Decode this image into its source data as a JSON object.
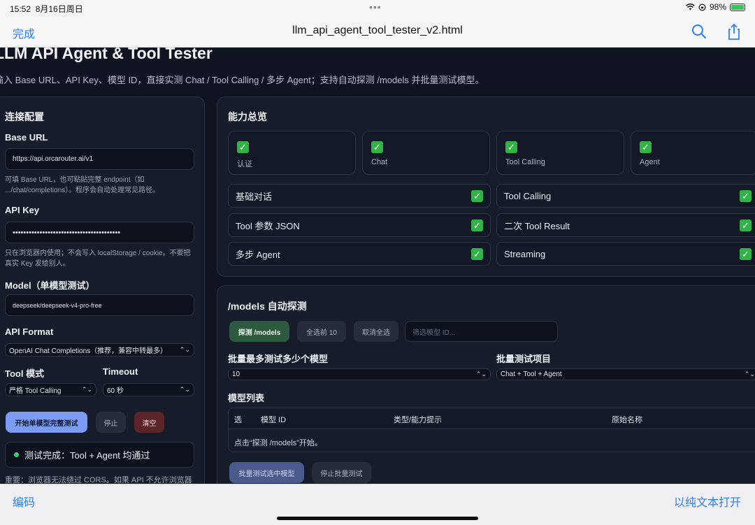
{
  "status_bar": {
    "time": "15:52",
    "date": "8月16日周日",
    "battery_percent": "98%",
    "battery_level": 0.98
  },
  "nav": {
    "done_label": "完成",
    "title": "llm_api_agent_tool_tester_v2.html",
    "search_icon": "search-icon",
    "share_icon": "share-icon"
  },
  "page": {
    "title": "LLM API Agent & Tool Tester",
    "description": "输入 Base URL、API Key、模型 ID，直接实测 Chat / Tool Calling / 多步 Agent；支持自动探测 /models 并批量测试模型。"
  },
  "config": {
    "heading": "连接配置",
    "base_url_label": "Base URL",
    "base_url_value": "https://api.orcarouter.ai/v1",
    "base_url_hint": "可填 Base URL，也可粘贴完整 endpoint（如 .../chat/completions）。程序会自动处理常见路径。",
    "api_key_label": "API Key",
    "api_key_value": "••••••••••••••••••••••••••••••••••••••••",
    "api_key_hint": "只在浏览器内使用；不会写入 localStorage / cookie。不要把真实 Key 发给别人。",
    "model_label": "Model（单模型测试）",
    "model_value": "deepseek/deepseek-v4-pro-free",
    "api_format_label": "API Format",
    "api_format_value": "OpenAI Chat Completions（推荐，兼容中转最多）",
    "tool_mode_label": "Tool 模式",
    "tool_mode_value": "严格 Tool Calling",
    "timeout_label": "Timeout",
    "timeout_value": "60 秒",
    "start_button": "开始单模型完整测试",
    "stop_button": "停止",
    "clear_button": "清空",
    "status_text": "测试完成：Tool + Agent 均通过",
    "footer_note": "重要：浏览器无法绕过 CORS。如果 API 不允许浏览器"
  },
  "capabilities": {
    "heading": "能力总览",
    "cards": [
      {
        "label": "认证"
      },
      {
        "label": "Chat"
      },
      {
        "label": "Tool Calling"
      },
      {
        "label": "Agent"
      }
    ],
    "rows": [
      {
        "label": "基础对话"
      },
      {
        "label": "Tool Calling"
      },
      {
        "label": "Tool 参数 JSON"
      },
      {
        "label": "二次 Tool Result"
      },
      {
        "label": "多步 Agent"
      },
      {
        "label": "Streaming"
      }
    ]
  },
  "models": {
    "heading": "/models 自动探测",
    "detect_button": "探测 /models",
    "select_top_button": "全选前 10",
    "deselect_button": "取消全选",
    "filter_placeholder": "筛选模型 ID...",
    "batch_max_label": "批量最多测试多少个模型",
    "batch_max_value": "10",
    "batch_items_label": "批量测试项目",
    "batch_items_value": "Chat + Tool + Agent",
    "list_label": "模型列表",
    "columns": [
      "选",
      "模型 ID",
      "类型/能力提示",
      "原始名称"
    ],
    "empty_text": "点击“探测 /models”开始。",
    "batch_test_button": "批量测试选中模型",
    "stop_batch_button": "停止批量测试"
  },
  "toolbar": {
    "encoding_label": "编码",
    "open_plain_label": "以纯文本打开"
  },
  "colors": {
    "accent": "#2f7ef6",
    "success": "#33b249",
    "primary_button": "#7b9cf2",
    "danger_button": "#5a2428"
  }
}
